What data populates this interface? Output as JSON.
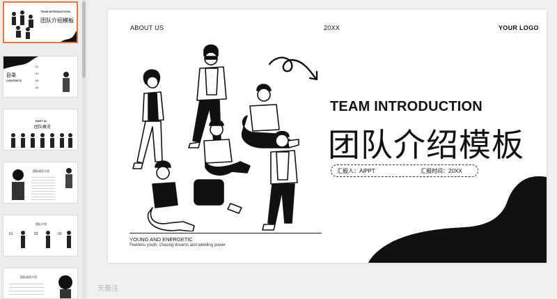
{
  "thumbnails": [
    {
      "label_small": "TEAM INTRODUCTION",
      "label_big": "团队介绍模板",
      "active": true
    },
    {
      "label_big": "目录",
      "label_small": "CONTENTS",
      "nums": [
        "01",
        "02",
        "03",
        "04"
      ]
    },
    {
      "label_small": "PART 01",
      "label_big": "团队概览"
    },
    {
      "label_small": "团队成员介绍"
    },
    {
      "label_small": "团队介绍",
      "nums": [
        "01",
        "02",
        "03"
      ]
    },
    {
      "label_small": "团队成员介绍"
    }
  ],
  "slide": {
    "header_left": "ABOUT US",
    "header_center": "20XX",
    "header_right": "YOUR LOGO",
    "title_en": "TEAM INTRODUCTION",
    "title_cn": "团队介绍模板",
    "reporter": "汇报人：AiPPT",
    "report_time": "汇报时间：20XX",
    "tagline": "YOUNG AND ENERGETIC",
    "subtagline": "Fearless youth, chasing dreams and wielding power"
  },
  "notes_placeholder": "无备注",
  "colors": {
    "accent": "#e07a3a",
    "ink": "#111111"
  }
}
